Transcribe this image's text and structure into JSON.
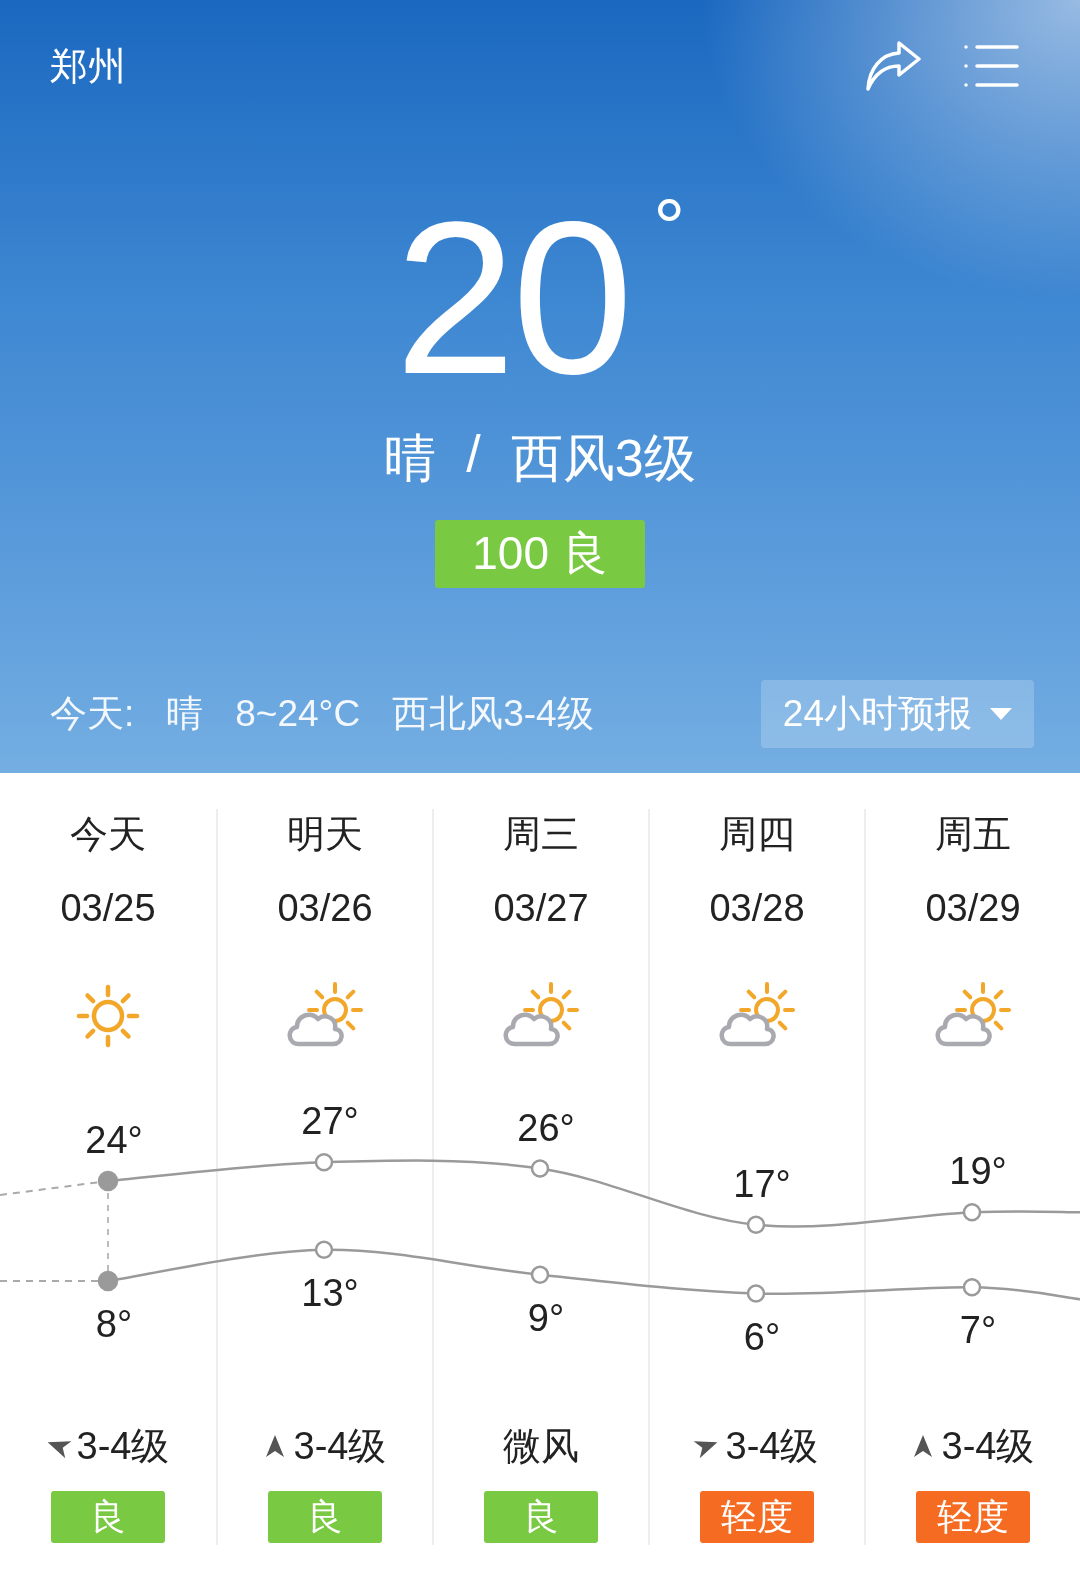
{
  "city": "郑州",
  "current": {
    "temperature": "20",
    "degree": "°",
    "condition": "晴",
    "separator": "/",
    "wind": "西风3级"
  },
  "aqi": {
    "value": "100",
    "level": "良",
    "color": "#7ac943"
  },
  "today": {
    "label": "今天:",
    "condition": "晴",
    "range": "8~24°C",
    "wind": "西北风3-4级"
  },
  "forecast_button": {
    "label": "24小时预报"
  },
  "days": [
    {
      "day": "今天",
      "date": "03/25",
      "weather": {
        "kind": "sunny"
      },
      "high": "24°",
      "low": "8°",
      "wind": {
        "kind": "west",
        "label": "3-4级"
      },
      "aqi": {
        "label": "良",
        "color": "#7ac943"
      }
    },
    {
      "day": "明天",
      "date": "03/26",
      "weather": {
        "kind": "partly-cloudy"
      },
      "high": "27°",
      "low": "13°",
      "wind": {
        "kind": "north",
        "label": "3-4级"
      },
      "aqi": {
        "label": "良",
        "color": "#7ac943"
      }
    },
    {
      "day": "周三",
      "date": "03/27",
      "weather": {
        "kind": "partly-cloudy"
      },
      "high": "26°",
      "low": "9°",
      "wind": {
        "label": "微风"
      },
      "aqi": {
        "label": "良",
        "color": "#7ac943"
      }
    },
    {
      "day": "周四",
      "date": "03/28",
      "weather": {
        "kind": "partly-cloudy"
      },
      "high": "17°",
      "low": "6°",
      "wind": {
        "kind": "east",
        "label": "3-4级"
      },
      "aqi": {
        "label": "轻度",
        "color": "#f56b22"
      }
    },
    {
      "day": "周五",
      "date": "03/29",
      "weather": {
        "kind": "partly-cloudy"
      },
      "high": "19°",
      "low": "7°",
      "wind": {
        "kind": "north",
        "label": "3-4级"
      },
      "aqi": {
        "label": "轻度",
        "color": "#f56b22"
      }
    }
  ]
}
